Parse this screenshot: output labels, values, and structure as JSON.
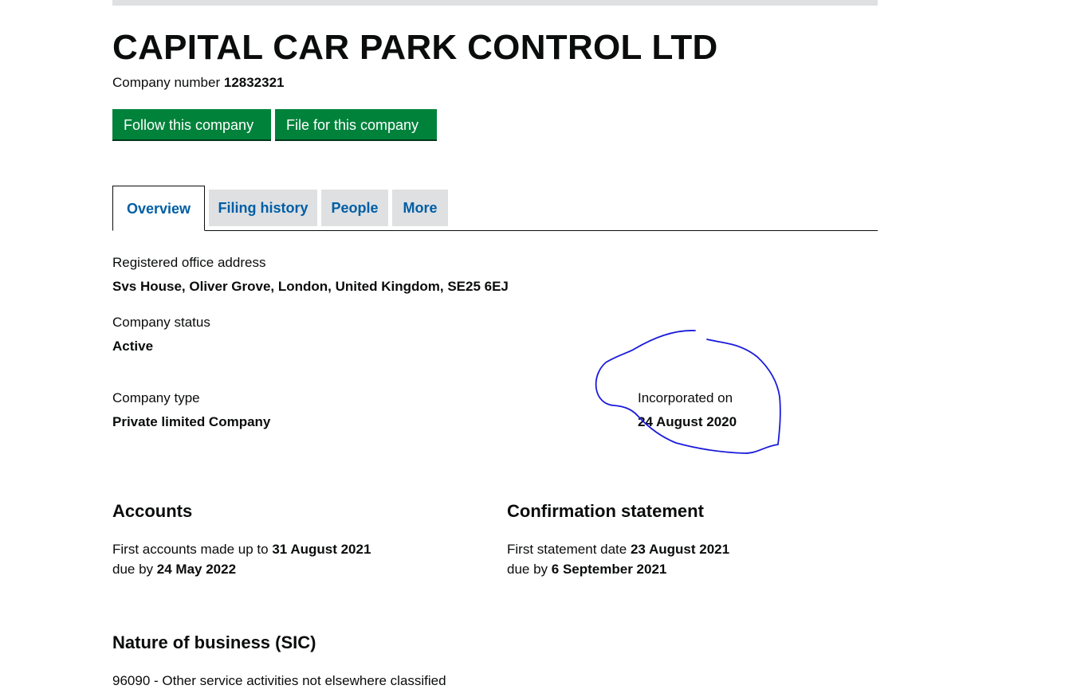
{
  "company": {
    "name": "CAPITAL CAR PARK CONTROL LTD",
    "number_label": "Company number",
    "number": "12832321"
  },
  "actions": {
    "follow_label": "Follow this company",
    "file_label": "File for this company"
  },
  "tabs": [
    {
      "label": "Overview",
      "active": true
    },
    {
      "label": "Filing history",
      "active": false
    },
    {
      "label": "People",
      "active": false
    },
    {
      "label": "More",
      "active": false
    }
  ],
  "overview": {
    "registered_office": {
      "label": "Registered office address",
      "value": "Svs House, Oliver Grove, London, United Kingdom, SE25 6EJ"
    },
    "status": {
      "label": "Company status",
      "value": "Active"
    },
    "type": {
      "label": "Company type",
      "value": "Private limited Company"
    },
    "incorporated": {
      "label": "Incorporated on",
      "value": "24 August 2020"
    }
  },
  "accounts": {
    "heading": "Accounts",
    "made_up_prefix": "First accounts made up to",
    "made_up_date": "31 August 2021",
    "due_prefix": "due by",
    "due_date": "24 May 2022"
  },
  "confirmation": {
    "heading": "Confirmation statement",
    "statement_prefix": "First statement date",
    "statement_date": "23 August 2021",
    "due_prefix": "due by",
    "due_date": "6 September 2021"
  },
  "sic": {
    "heading": "Nature of business (SIC)",
    "code_line": "96090 - Other service activities not elsewhere classified"
  },
  "colors": {
    "button_green": "#00823b",
    "link_blue": "#005ea5",
    "tab_grey": "#dee0e2",
    "annotation_ink": "#1a1adb"
  }
}
